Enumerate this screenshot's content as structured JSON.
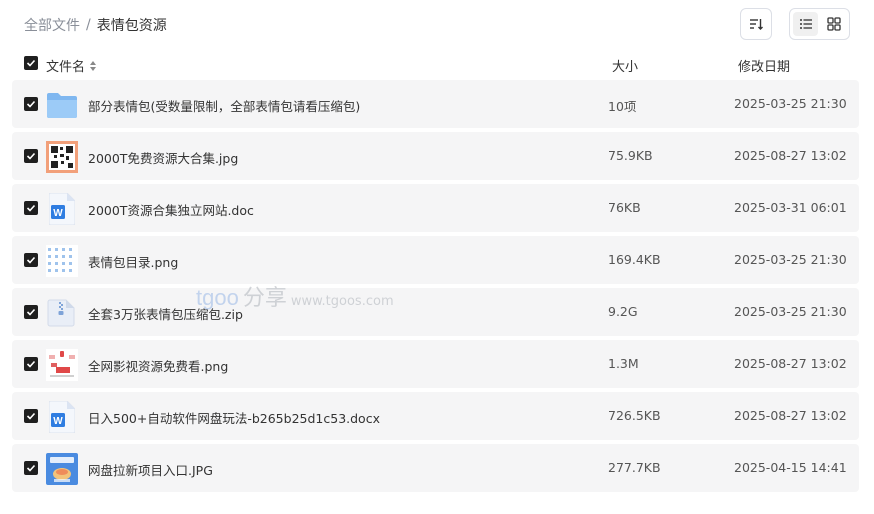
{
  "breadcrumb": {
    "root": "全部文件",
    "separator": "/",
    "current": "表情包资源"
  },
  "columns": {
    "name": "文件名",
    "size": "大小",
    "date": "修改日期"
  },
  "files": [
    {
      "name": "部分表情包(受数量限制，全部表情包请看压缩包)",
      "size": "10项",
      "date": "2025-03-25 21:30",
      "icon": "folder-icon",
      "checked": true
    },
    {
      "name": "2000T免费资源大合集.jpg",
      "size": "75.9KB",
      "date": "2025-08-27 13:02",
      "icon": "qr-image-icon",
      "checked": true
    },
    {
      "name": "2000T资源合集独立网站.doc",
      "size": "76KB",
      "date": "2025-03-31 06:01",
      "icon": "word-doc-icon",
      "checked": true
    },
    {
      "name": "表情包目录.png",
      "size": "169.4KB",
      "date": "2025-03-25 21:30",
      "icon": "grid-image-icon",
      "checked": true
    },
    {
      "name": "全套3万张表情包压缩包.zip",
      "size": "9.2G",
      "date": "2025-03-25 21:30",
      "icon": "zip-icon",
      "checked": true
    },
    {
      "name": "全网影视资源免费看.png",
      "size": "1.3M",
      "date": "2025-08-27 13:02",
      "icon": "poster-image-icon",
      "checked": true
    },
    {
      "name": "日入500+自动软件网盘玩法-b265b25d1c53.docx",
      "size": "726.5KB",
      "date": "2025-08-27 13:02",
      "icon": "word-doc-icon",
      "checked": true
    },
    {
      "name": "网盘拉新项目入口.JPG",
      "size": "277.7KB",
      "date": "2025-04-15 14:41",
      "icon": "photo-image-icon",
      "checked": true
    }
  ],
  "watermark": {
    "logo": "tgoo",
    "text": "分享",
    "url": "www.tgoos.com"
  }
}
